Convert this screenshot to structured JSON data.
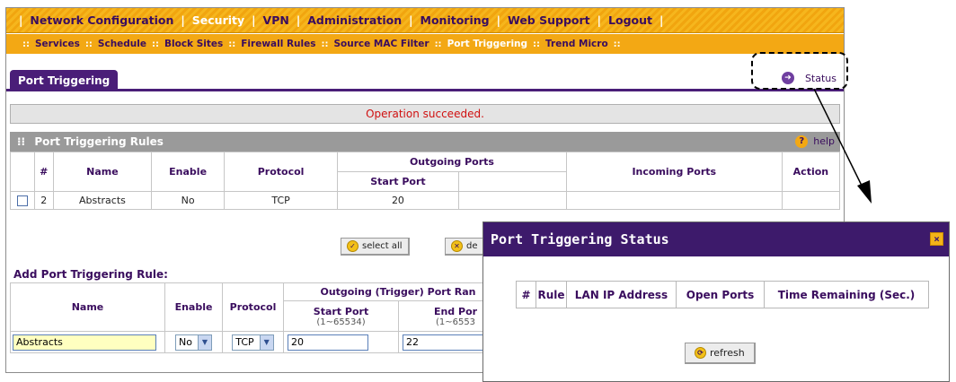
{
  "topnav": {
    "items": [
      "Network Configuration",
      "Security",
      "VPN",
      "Administration",
      "Monitoring",
      "Web Support",
      "Logout"
    ],
    "active_index": 1
  },
  "subnav": {
    "items": [
      "Services",
      "Schedule",
      "Block Sites",
      "Firewall Rules",
      "Source MAC Filter",
      "Port Triggering",
      "Trend Micro"
    ],
    "active_index": 5
  },
  "page_tab": "Port Triggering",
  "status_link": "Status",
  "message": "Operation succeeded.",
  "rules_section": {
    "title": "Port Triggering Rules",
    "help": "help",
    "headers": {
      "num": "#",
      "name": "Name",
      "enable": "Enable",
      "protocol": "Protocol",
      "outgoing": "Outgoing Ports",
      "incoming": "Incoming Ports",
      "action": "Action",
      "start_port": "Start Port"
    },
    "rows": [
      {
        "num": "2",
        "name": "Abstracts",
        "enable": "No",
        "protocol": "TCP",
        "start_port": "20"
      }
    ]
  },
  "buttons": {
    "select_all": "select all",
    "delete": "de"
  },
  "add_rule": {
    "title": "Add Port Triggering Rule:",
    "headers": {
      "name": "Name",
      "enable": "Enable",
      "protocol": "Protocol",
      "outgoing": "Outgoing (Trigger) Port Ran",
      "start_port": "Start Port",
      "start_range": "(1~65534)",
      "end_port": "End Por",
      "end_range": "(1~6553"
    },
    "values": {
      "name": "Abstracts",
      "enable": "No",
      "protocol": "TCP",
      "start_port": "20",
      "end_port": "22"
    }
  },
  "popup": {
    "title": "Port Triggering Status",
    "close": "×",
    "headers": [
      "#",
      "Rule",
      "LAN IP Address",
      "Open Ports",
      "Time Remaining (Sec.)"
    ],
    "refresh": "refresh"
  },
  "colors": {
    "nav_orange": "#f3a814",
    "purple": "#3d1a6b",
    "message_red": "#d01010"
  }
}
